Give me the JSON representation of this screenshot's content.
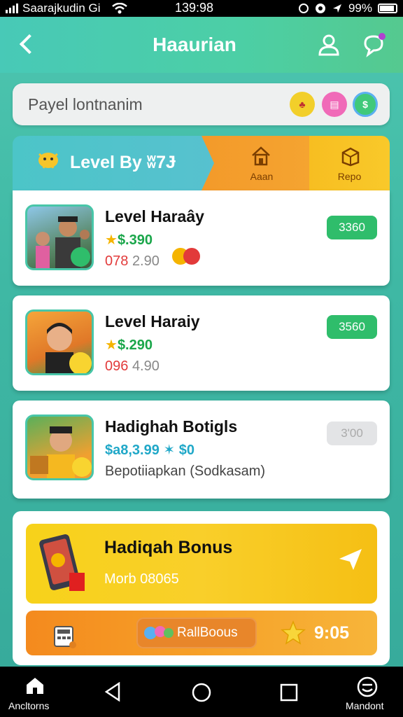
{
  "status_bar": {
    "carrier": "Saarajkudin Gi",
    "time": "139:98",
    "battery": "99%"
  },
  "header": {
    "title": "Haaurian"
  },
  "search": {
    "placeholder": "Payel lontnanim",
    "badges": [
      "yellow-badge",
      "pink-badge",
      "green-badge"
    ]
  },
  "tabs": {
    "level_label": "Level By",
    "level_value": "ʬ7Ɉ",
    "aran_label": "Aaan",
    "repo_label": "Repo"
  },
  "cards": [
    {
      "title": "Level Haraây",
      "price": "$.390",
      "sub_red": "078",
      "sub_grey": "2.90",
      "button": "3360"
    },
    {
      "title": "Level Haraiy",
      "price": "$.290",
      "sub_red": "096",
      "sub_grey": "4.90",
      "button": "3560"
    },
    {
      "title": "Hadighah Botigls",
      "price": "$a8,3.99 ✶ $0",
      "sub_plain": "Bepotiiapkan  (Sodkasam)",
      "button": "3'00"
    }
  ],
  "bonus": {
    "title": "Hadiqah Bonus",
    "subtitle": "Morb 08065"
  },
  "bonus_bar": {
    "pill_label": "RallBoous",
    "value": "9:05"
  },
  "bottom_nav": {
    "home_label": "Ancltorns",
    "profile_label": "Mandont"
  },
  "colors": {
    "teal": "#4ec6b0",
    "green_button": "#2fbd6b",
    "orange": "#f48a1e",
    "yellow": "#f7d21a"
  }
}
